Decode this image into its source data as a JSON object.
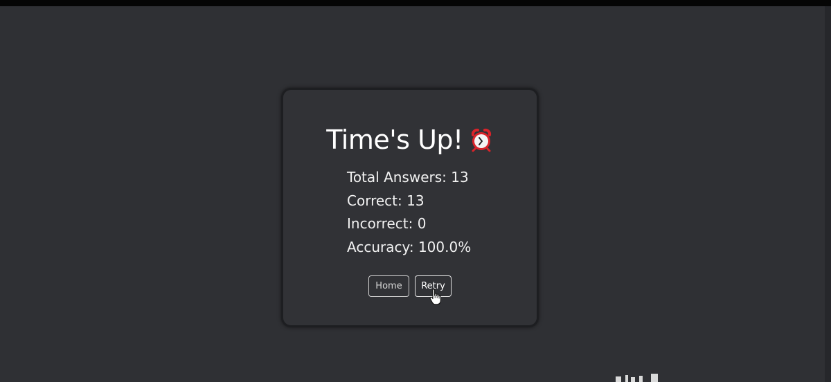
{
  "results": {
    "title": "Time's Up!",
    "title_icon": "alarm-clock-icon",
    "stats": [
      "Total Answers: 13",
      "Correct: 13",
      "Incorrect: 0",
      "Accuracy: 100.0%"
    ],
    "buttons": {
      "home_label": "Home",
      "retry_label": "Retry"
    }
  },
  "colors": {
    "background": "#2f3034",
    "card": "#313236",
    "clock_red": "#d8232a",
    "text": "#ffffff"
  }
}
